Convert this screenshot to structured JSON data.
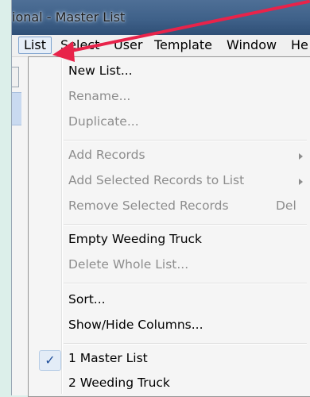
{
  "window": {
    "title": "ional - Master List"
  },
  "menubar": {
    "items": [
      "List",
      "Select",
      "User",
      "Template",
      "Window",
      "He"
    ]
  },
  "dropdown": {
    "items": [
      {
        "label": "New List...",
        "enabled": true
      },
      {
        "label": "Rename...",
        "enabled": false
      },
      {
        "label": "Duplicate...",
        "enabled": false
      },
      {
        "label": "Add Records",
        "enabled": false,
        "submenu": true
      },
      {
        "label": "Add Selected Records to List",
        "enabled": false,
        "submenu": true
      },
      {
        "label": "Remove Selected Records",
        "enabled": false,
        "shortcut": "Del"
      },
      {
        "label": "Empty Weeding Truck",
        "enabled": true
      },
      {
        "label": "Delete Whole List...",
        "enabled": false
      },
      {
        "label": "Sort...",
        "enabled": true
      },
      {
        "label": "Show/Hide Columns...",
        "enabled": true
      },
      {
        "label": "1 Master List",
        "enabled": true,
        "checked": true,
        "check_mark": "✓"
      },
      {
        "label": "2 Weeding Truck",
        "enabled": true
      }
    ]
  },
  "colors": {
    "annotation_arrow": "#e8234a",
    "titlebar": "#3f6189",
    "menu_highlight_border": "#7da2ce"
  }
}
